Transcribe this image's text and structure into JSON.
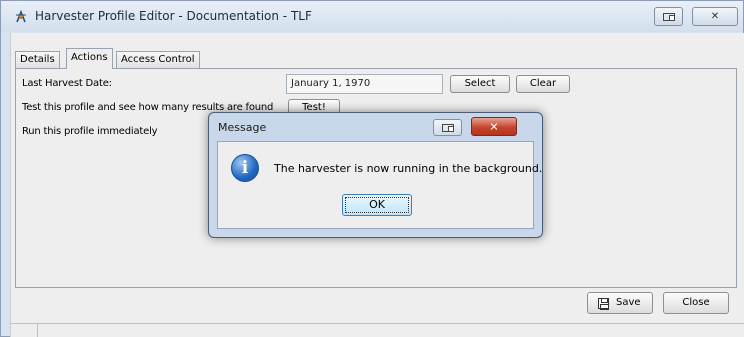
{
  "window": {
    "title": "Harvester Profile Editor - Documentation - TLF",
    "app_icon": "harvester-icon",
    "restore_icon": "restore-icon",
    "close_glyph": "✕"
  },
  "tabs": [
    {
      "label": "Details",
      "active": false
    },
    {
      "label": "Actions",
      "active": true
    },
    {
      "label": "Access Control",
      "active": false
    }
  ],
  "actions": {
    "last_harvest_label": "Last Harvest Date:",
    "last_harvest_value": "January 1, 1970",
    "select_label": "Select",
    "clear_label": "Clear",
    "test_label": "Test this profile and see how many results are found",
    "test_button": "Test!",
    "run_label": "Run this profile immediately"
  },
  "footer": {
    "save_label": "Save",
    "close_label": "Close"
  },
  "dialog": {
    "title": "Message",
    "message": "The harvester is now running in the background.",
    "ok_label": "OK",
    "close_glyph": "✕",
    "icon": "info-icon",
    "info_glyph": "i"
  }
}
